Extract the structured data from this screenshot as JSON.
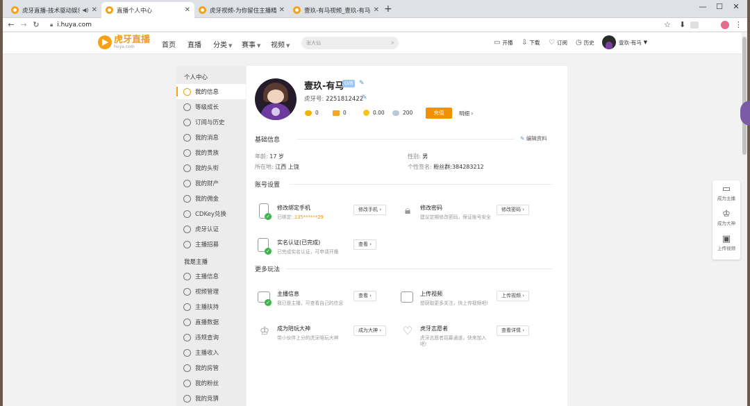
{
  "browser": {
    "tabs": [
      {
        "title": "虎牙直播-技术驱动娱乐-弹幕式互动直播平台",
        "active": false,
        "audio": true
      },
      {
        "title": "直播个人中心",
        "active": true
      },
      {
        "title": "虎牙视频-为你留住主播精彩时刻",
        "active": false
      },
      {
        "title": "壹玖-有马视频_壹玖-有马直播视频",
        "active": false
      }
    ],
    "url": "i.huya.com"
  },
  "header": {
    "logo_name": "虎牙直播",
    "logo_sub": "huya.com",
    "nav": [
      "首页",
      "直播",
      "分类",
      "赛事",
      "视频"
    ],
    "search_placeholder": "张大仙",
    "actions": [
      "开播",
      "下载",
      "订阅",
      "历史"
    ],
    "user_name": "壹玖-有马"
  },
  "sidebar": {
    "group1": "个人中心",
    "items1": [
      "我的信息",
      "等级成长",
      "订阅与历史",
      "我的消息",
      "我的贵族",
      "我的头衔",
      "我的财产",
      "我的佣金",
      "CDKey兑换",
      "虎牙认证",
      "主播招募"
    ],
    "group2": "我是主播",
    "items2": [
      "主播信息",
      "视频管理",
      "主播扶持",
      "直播数据",
      "违规查询",
      "主播收入",
      "我的房管",
      "我的粉丝",
      "我的竞猜"
    ]
  },
  "profile": {
    "name": "壹玖-有马",
    "level": "LV8",
    "huya_id_label": "虎牙号:",
    "huya_id": "2251812422",
    "stats": [
      "0",
      "0",
      "0.00",
      "200"
    ],
    "recharge": "充值",
    "detail": "明细"
  },
  "basic": {
    "title": "基础信息",
    "edit": "编辑资料",
    "age_label": "年龄:",
    "age": "17 岁",
    "gender_label": "性别:",
    "gender": "男",
    "location_label": "所在地:",
    "location": "江西 上饶",
    "sign_label": "个性签名:",
    "sign": "粉丝群:384283212"
  },
  "account": {
    "title": "账号设置",
    "phone_title": "修改绑定手机",
    "phone_desc_prefix": "已绑定:",
    "phone_number": "135******29",
    "phone_btn": "修改手机",
    "pwd_title": "修改密码",
    "pwd_desc": "建议定期修改密码，保证账号安全",
    "pwd_btn": "修改密码",
    "real_title": "实名认证(已完成)",
    "real_desc": "已完成实名认证，可申请开播",
    "real_btn": "查看"
  },
  "more": {
    "title": "更多玩法",
    "anchor_title": "主播信息",
    "anchor_desc": "我已是主播，可查看自己的信息",
    "anchor_btn": "查看",
    "upload_title": "上传视频",
    "upload_desc": "想获取更多关注，快上传视频吧!",
    "upload_btn": "上传视频",
    "god_title": "成为陪玩大神",
    "god_desc": "带小伙伴上分的虎牙陪玩大神",
    "god_btn": "成为大神",
    "vol_title": "虎牙志愿者",
    "vol_desc1": "虎牙志愿者招募通道，快来加入",
    "vol_desc2": "吧!",
    "vol_btn": "查看详情"
  },
  "float_panel": [
    "成为主播",
    "成为大神",
    "上传视频"
  ],
  "colors": {
    "accent": "#f39000",
    "brand": "#f7a11a",
    "check": "#3cb54a"
  }
}
